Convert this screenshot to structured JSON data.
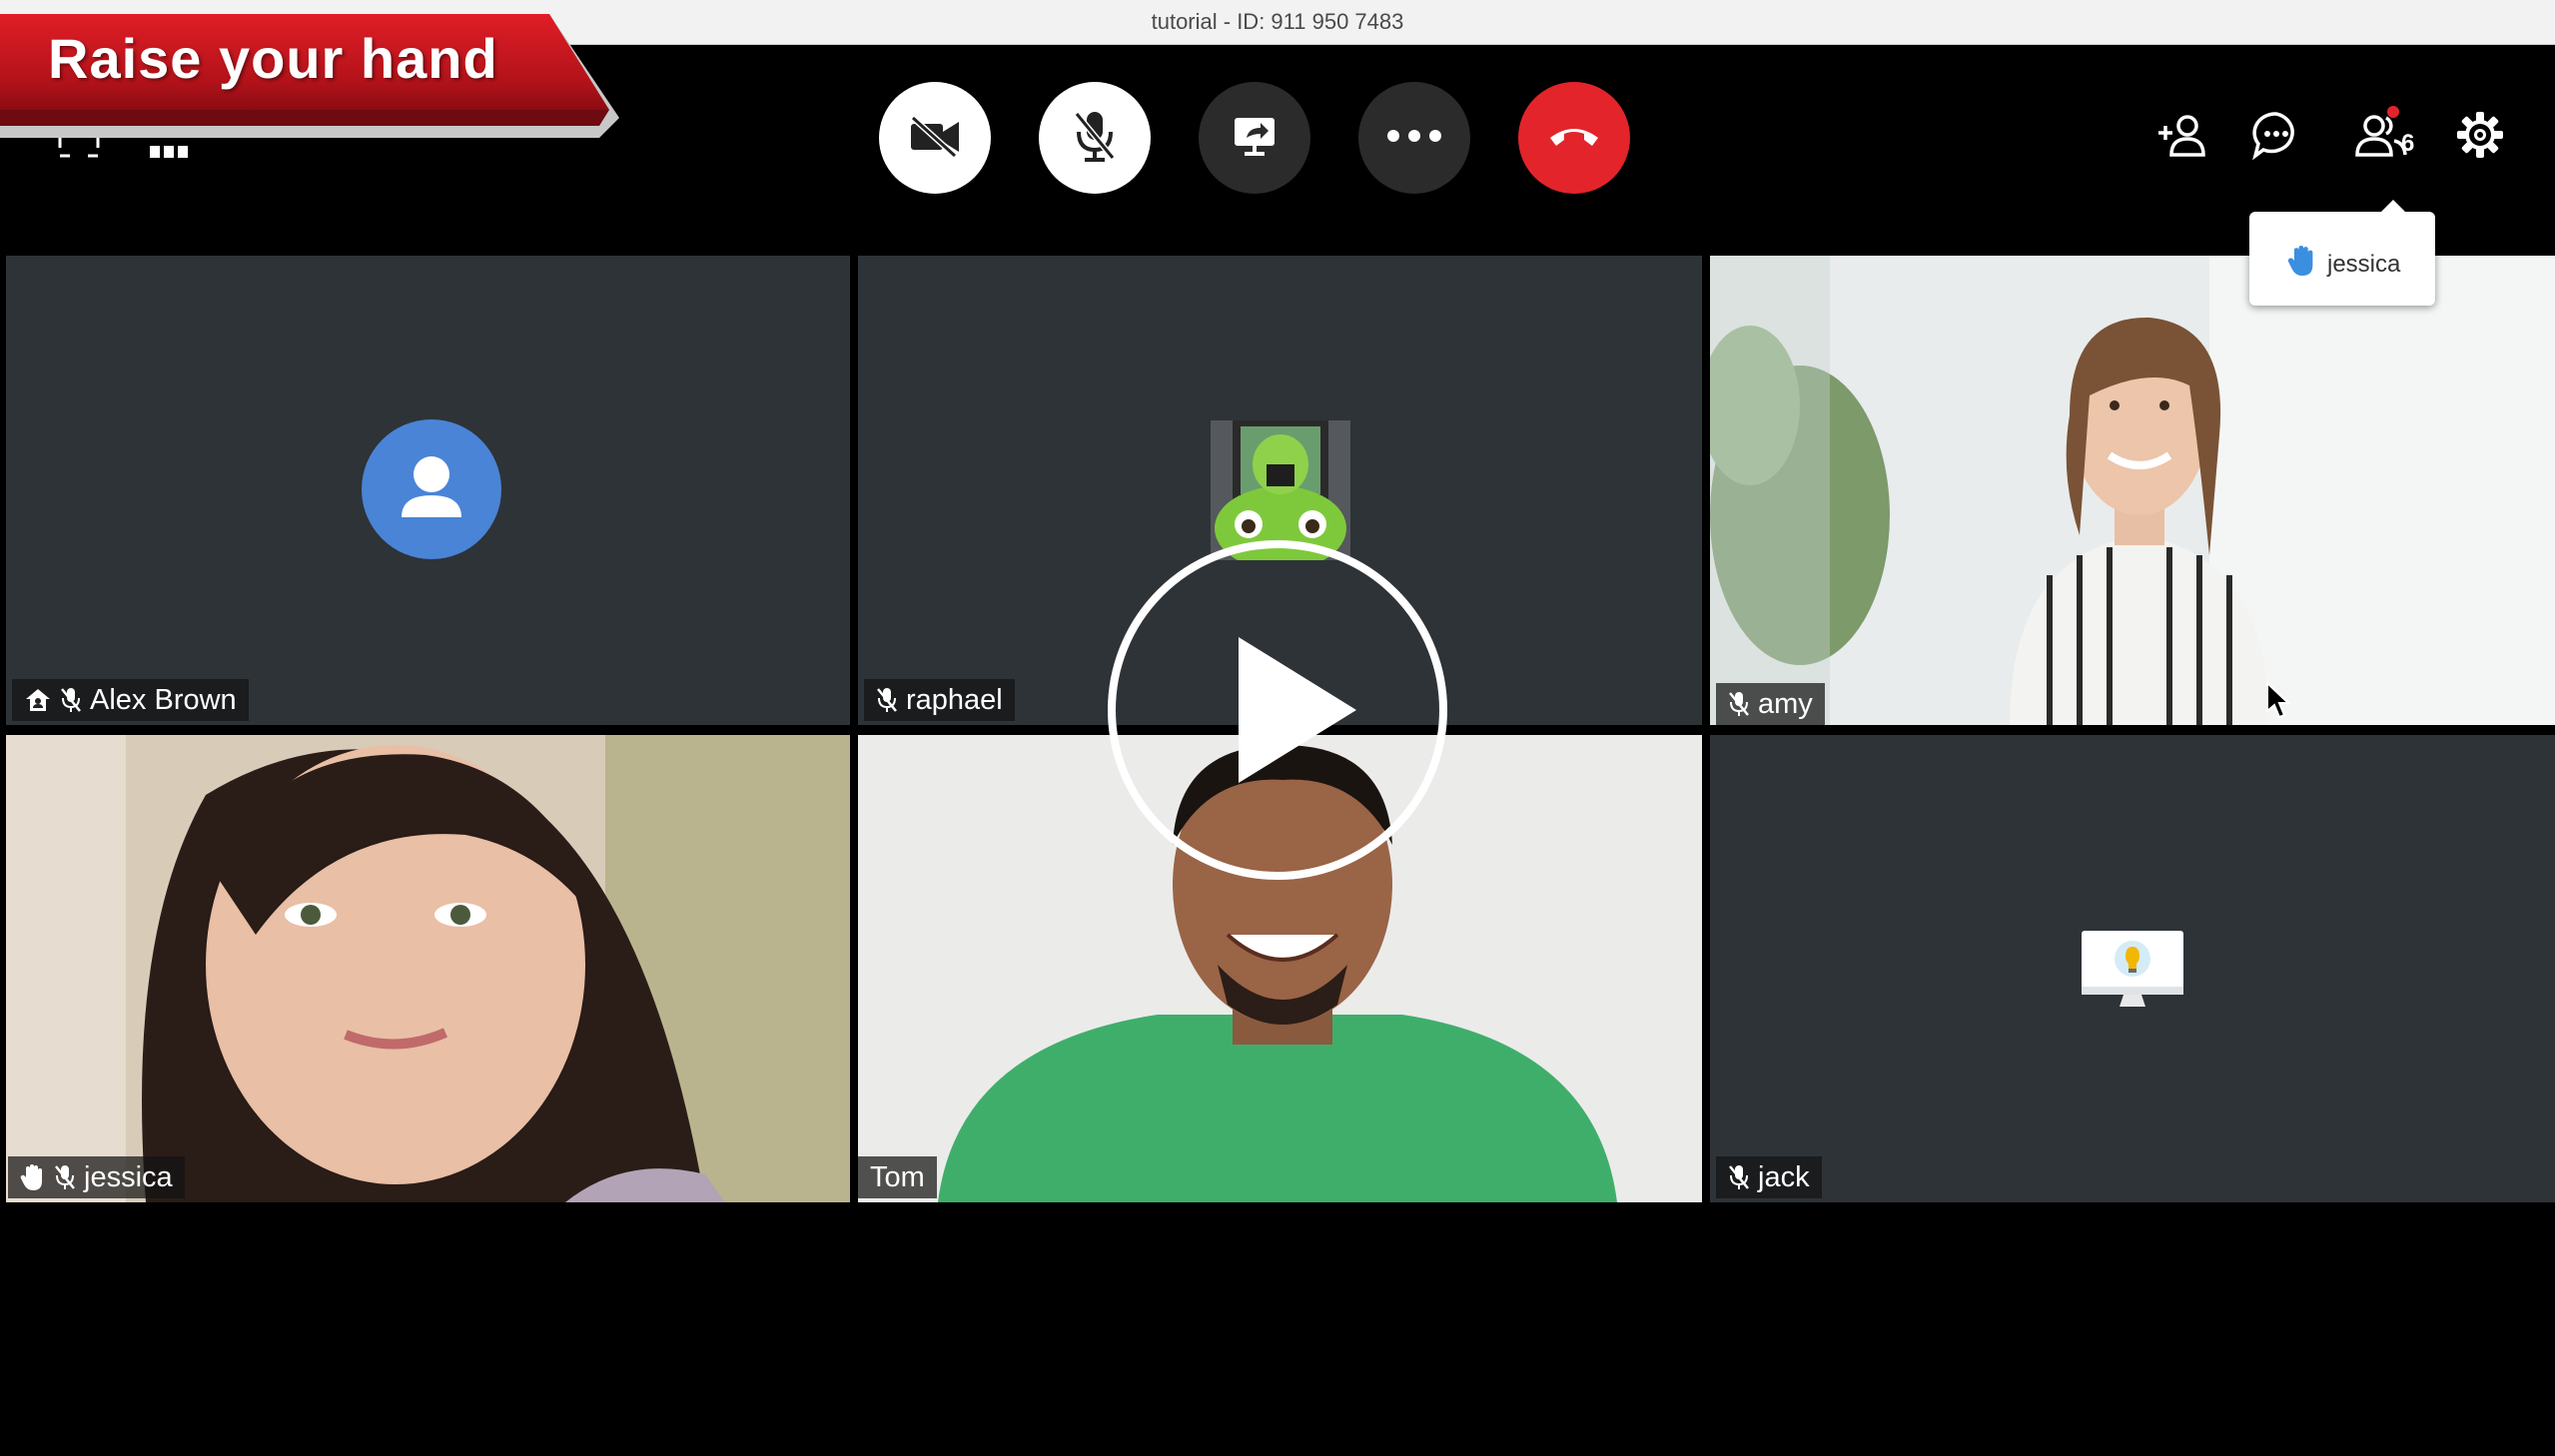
{
  "window": {
    "title": "tutorial - ID: 911 950 7483"
  },
  "banner": {
    "text": "Raise your hand"
  },
  "toolbar": {
    "buttons": [
      {
        "name": "camera-off",
        "icon": "video-off-icon"
      },
      {
        "name": "mic-off",
        "icon": "mic-off-icon"
      },
      {
        "name": "share-screen",
        "icon": "screen-share-icon"
      },
      {
        "name": "more",
        "icon": "more-icon"
      },
      {
        "name": "leave",
        "icon": "hang-up-icon"
      }
    ]
  },
  "top_right": {
    "icons": [
      "add-person-icon",
      "chat-icon",
      "participants-icon",
      "settings-icon"
    ],
    "participant_count": "6"
  },
  "raise_hand_popover": {
    "name": "jessica"
  },
  "participants": [
    {
      "name": "Alex Brown",
      "muted": true,
      "host": true,
      "video": false
    },
    {
      "name": "raphael",
      "muted": true,
      "video": false
    },
    {
      "name": "amy",
      "muted": true,
      "video": true
    },
    {
      "name": "jessica",
      "muted": true,
      "hand_raised": true,
      "video": true
    },
    {
      "name": "Tom",
      "muted": false,
      "video": true
    },
    {
      "name": "jack",
      "muted": true,
      "video": false
    }
  ],
  "colors": {
    "accent_red": "#e3242b",
    "avatar_blue": "#4a84d6",
    "tile_bg": "#2e3338",
    "banner_red": "#c8141c"
  }
}
